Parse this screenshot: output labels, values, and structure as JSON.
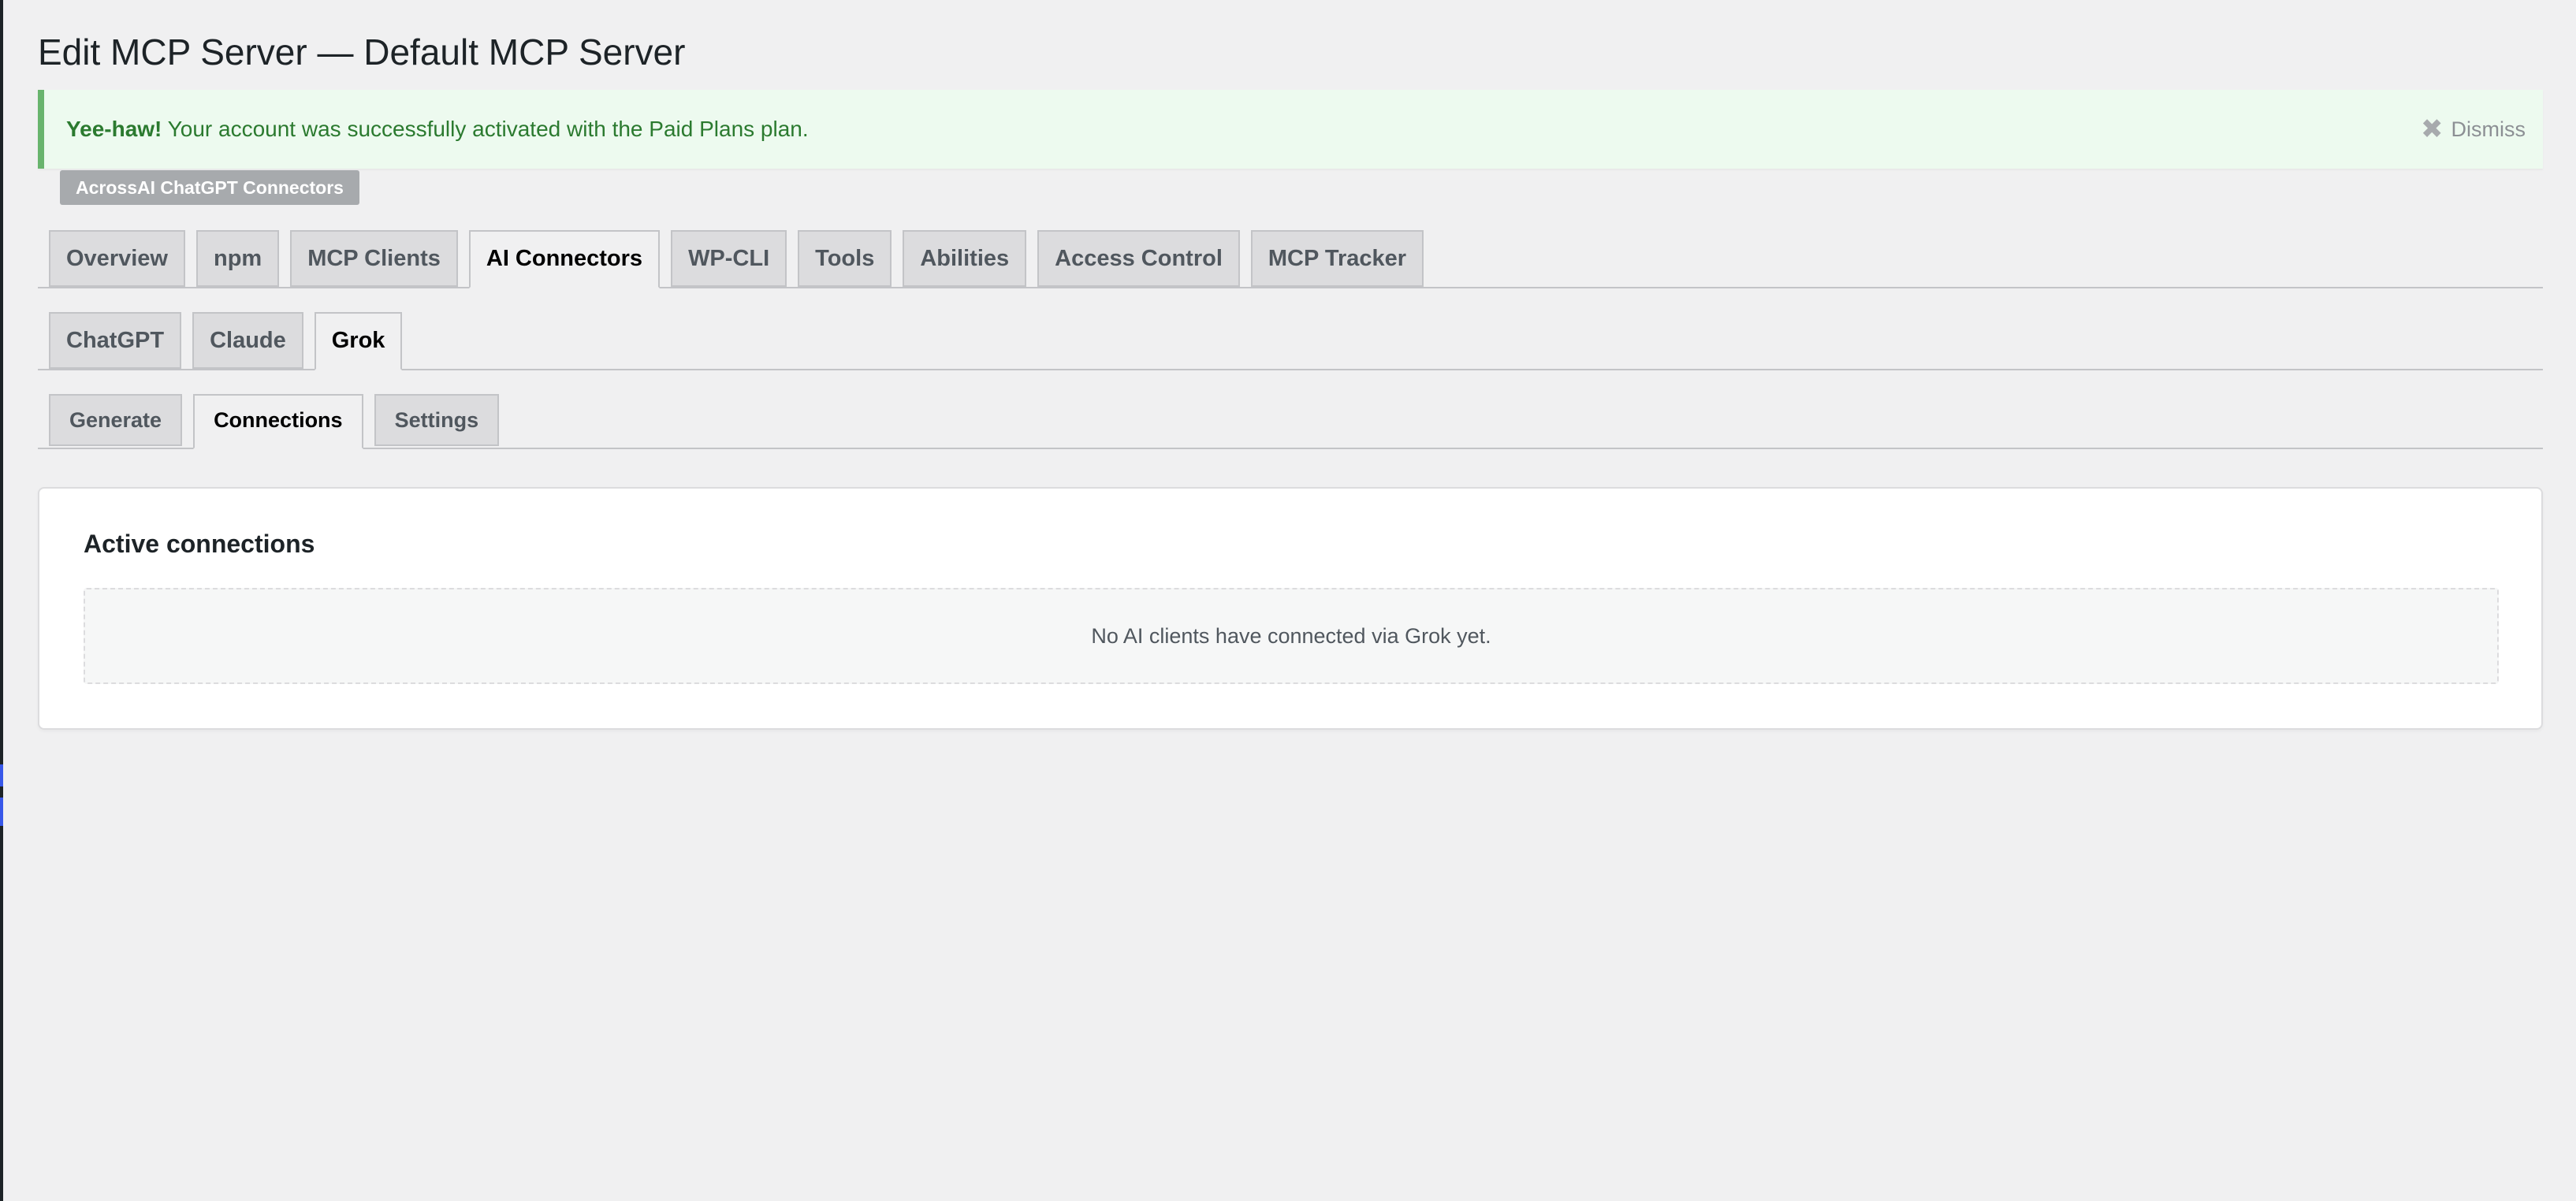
{
  "page": {
    "title": "Edit MCP Server — Default MCP Server"
  },
  "notice": {
    "strong": "Yee-haw!",
    "message": " Your account was successfully activated with the Paid Plans plan.",
    "dismiss_label": "Dismiss",
    "dismiss_icon": "close-icon"
  },
  "plugin_badge": "AcrossAI ChatGPT Connectors",
  "main_tabs": {
    "overview": "Overview",
    "npm": "npm",
    "mcp_clients": "MCP Clients",
    "ai_connectors": "AI Connectors",
    "wp_cli": "WP-CLI",
    "tools": "Tools",
    "abilities": "Abilities",
    "access_control": "Access Control",
    "mcp_tracker": "MCP Tracker",
    "active": "ai_connectors"
  },
  "connector_tabs": {
    "chatgpt": "ChatGPT",
    "claude": "Claude",
    "grok": "Grok",
    "active": "grok"
  },
  "section_tabs": {
    "generate": "Generate",
    "connections": "Connections",
    "settings": "Settings",
    "active": "connections"
  },
  "connections_card": {
    "title": "Active connections",
    "empty_message": "No AI clients have connected via Grok yet."
  },
  "colors": {
    "success_border": "#68b46d",
    "success_bg": "#edfaef",
    "success_text": "#2b7a2f",
    "badge_bg": "#a7aaad",
    "page_bg": "#f0f0f1"
  }
}
